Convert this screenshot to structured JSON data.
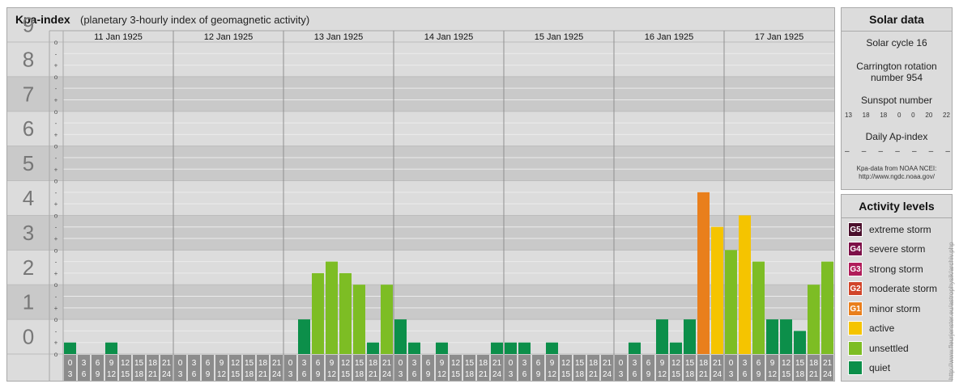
{
  "chart_data": {
    "type": "bar",
    "title": "Kpa-index",
    "subtitle": "(planetary 3-hourly index of geomagnetic activity)",
    "days": [
      "11 Jan 1925",
      "12 Jan 1925",
      "13 Jan 1925",
      "14 Jan 1925",
      "15 Jan 1925",
      "16 Jan 1925",
      "17 Jan 1925"
    ],
    "interval_starts": [
      "0",
      "3",
      "6",
      "9",
      "12",
      "15",
      "18",
      "21"
    ],
    "interval_ends": [
      "3",
      "6",
      "9",
      "12",
      "15",
      "18",
      "21",
      "24"
    ],
    "ylim": [
      0,
      9
    ],
    "y_major_labels": [
      "0",
      "1",
      "2",
      "3",
      "4",
      "5",
      "6",
      "7",
      "8",
      "9"
    ],
    "y_minor_labels": [
      "o",
      "+",
      "-"
    ],
    "values": [
      0.333,
      0,
      0,
      0.333,
      0,
      0,
      0,
      0,
      0,
      0,
      0,
      0,
      0,
      0,
      0,
      0,
      0,
      1,
      2.333,
      2.667,
      2.333,
      2,
      0.333,
      2,
      1,
      0.333,
      0,
      0.333,
      0,
      0,
      0,
      0.333,
      0.333,
      0.333,
      0,
      0.333,
      0,
      0,
      0,
      0,
      0,
      0.333,
      0,
      1,
      0.333,
      1,
      4.667,
      3.667,
      3,
      4,
      2.667,
      1,
      1,
      0.667,
      2,
      2.667
    ],
    "colors": {
      "quiet": "#0c8f4a",
      "unsettled": "#7dbd24",
      "active": "#f5c400",
      "minor": "#e97f1c",
      "moderate": "#d1452a",
      "strong": "#b01d5a",
      "severe": "#7d1048",
      "extreme": "#4a0f2c"
    }
  },
  "solar_data": {
    "title": "Solar data",
    "solar_cycle": "Solar cycle 16",
    "carrington_line1": "Carrington rotation",
    "carrington_line2": "number 954",
    "sunspot_label": "Sunspot number",
    "sunspot_values": [
      "13",
      "18",
      "18",
      "0",
      "0",
      "20",
      "22"
    ],
    "ap_label": "Daily Ap-index",
    "ap_values": [
      "–",
      "–",
      "–",
      "–",
      "–",
      "–",
      "–"
    ],
    "source_line1": "Kpa-data from NOAA NCEI:",
    "source_line2": "http://www.ngdc.noaa.gov/"
  },
  "activity_levels": {
    "title": "Activity levels",
    "items": [
      {
        "code": "G5",
        "label": "extreme storm",
        "color": "#4a0f2c"
      },
      {
        "code": "G4",
        "label": "severe storm",
        "color": "#7d1048"
      },
      {
        "code": "G3",
        "label": "strong storm",
        "color": "#b01d5a"
      },
      {
        "code": "G2",
        "label": "moderate storm",
        "color": "#d1452a"
      },
      {
        "code": "G1",
        "label": "minor storm",
        "color": "#e97f1c"
      },
      {
        "code": "",
        "label": "active",
        "color": "#f5c400"
      },
      {
        "code": "",
        "label": "unsettled",
        "color": "#7dbd24"
      },
      {
        "code": "",
        "label": "quiet",
        "color": "#0c8f4a"
      }
    ]
  },
  "credit": "http://www.fleurjenster.eu/astrophysik/archiv.php"
}
